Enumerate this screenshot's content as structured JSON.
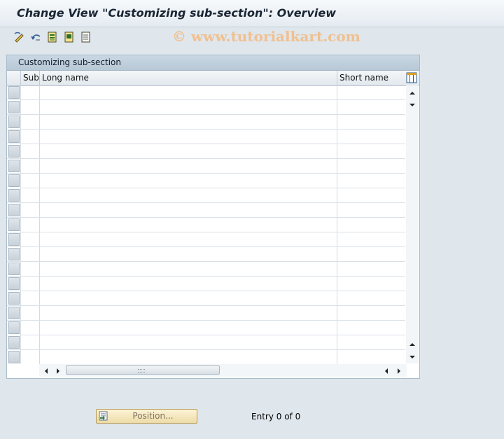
{
  "window": {
    "title": "Change View \"Customizing sub-section\": Overview",
    "watermark": "© www.tutorialkart.com"
  },
  "toolbar": {
    "buttons": [
      {
        "name": "change-display-icon"
      },
      {
        "name": "undo-icon"
      },
      {
        "name": "select-all-icon"
      },
      {
        "name": "select-block-icon"
      },
      {
        "name": "deselect-all-icon"
      }
    ]
  },
  "table": {
    "title": "Customizing sub-section",
    "columns": [
      "Sub",
      "Long name",
      "Short name"
    ],
    "row_count": 19,
    "rows": []
  },
  "footer": {
    "position_button": "Position...",
    "entry_text": "Entry 0 of 0"
  },
  "colors": {
    "background": "#dfe6ec",
    "title_text": "#1a2533",
    "button_bg": "#f3e6bf"
  }
}
